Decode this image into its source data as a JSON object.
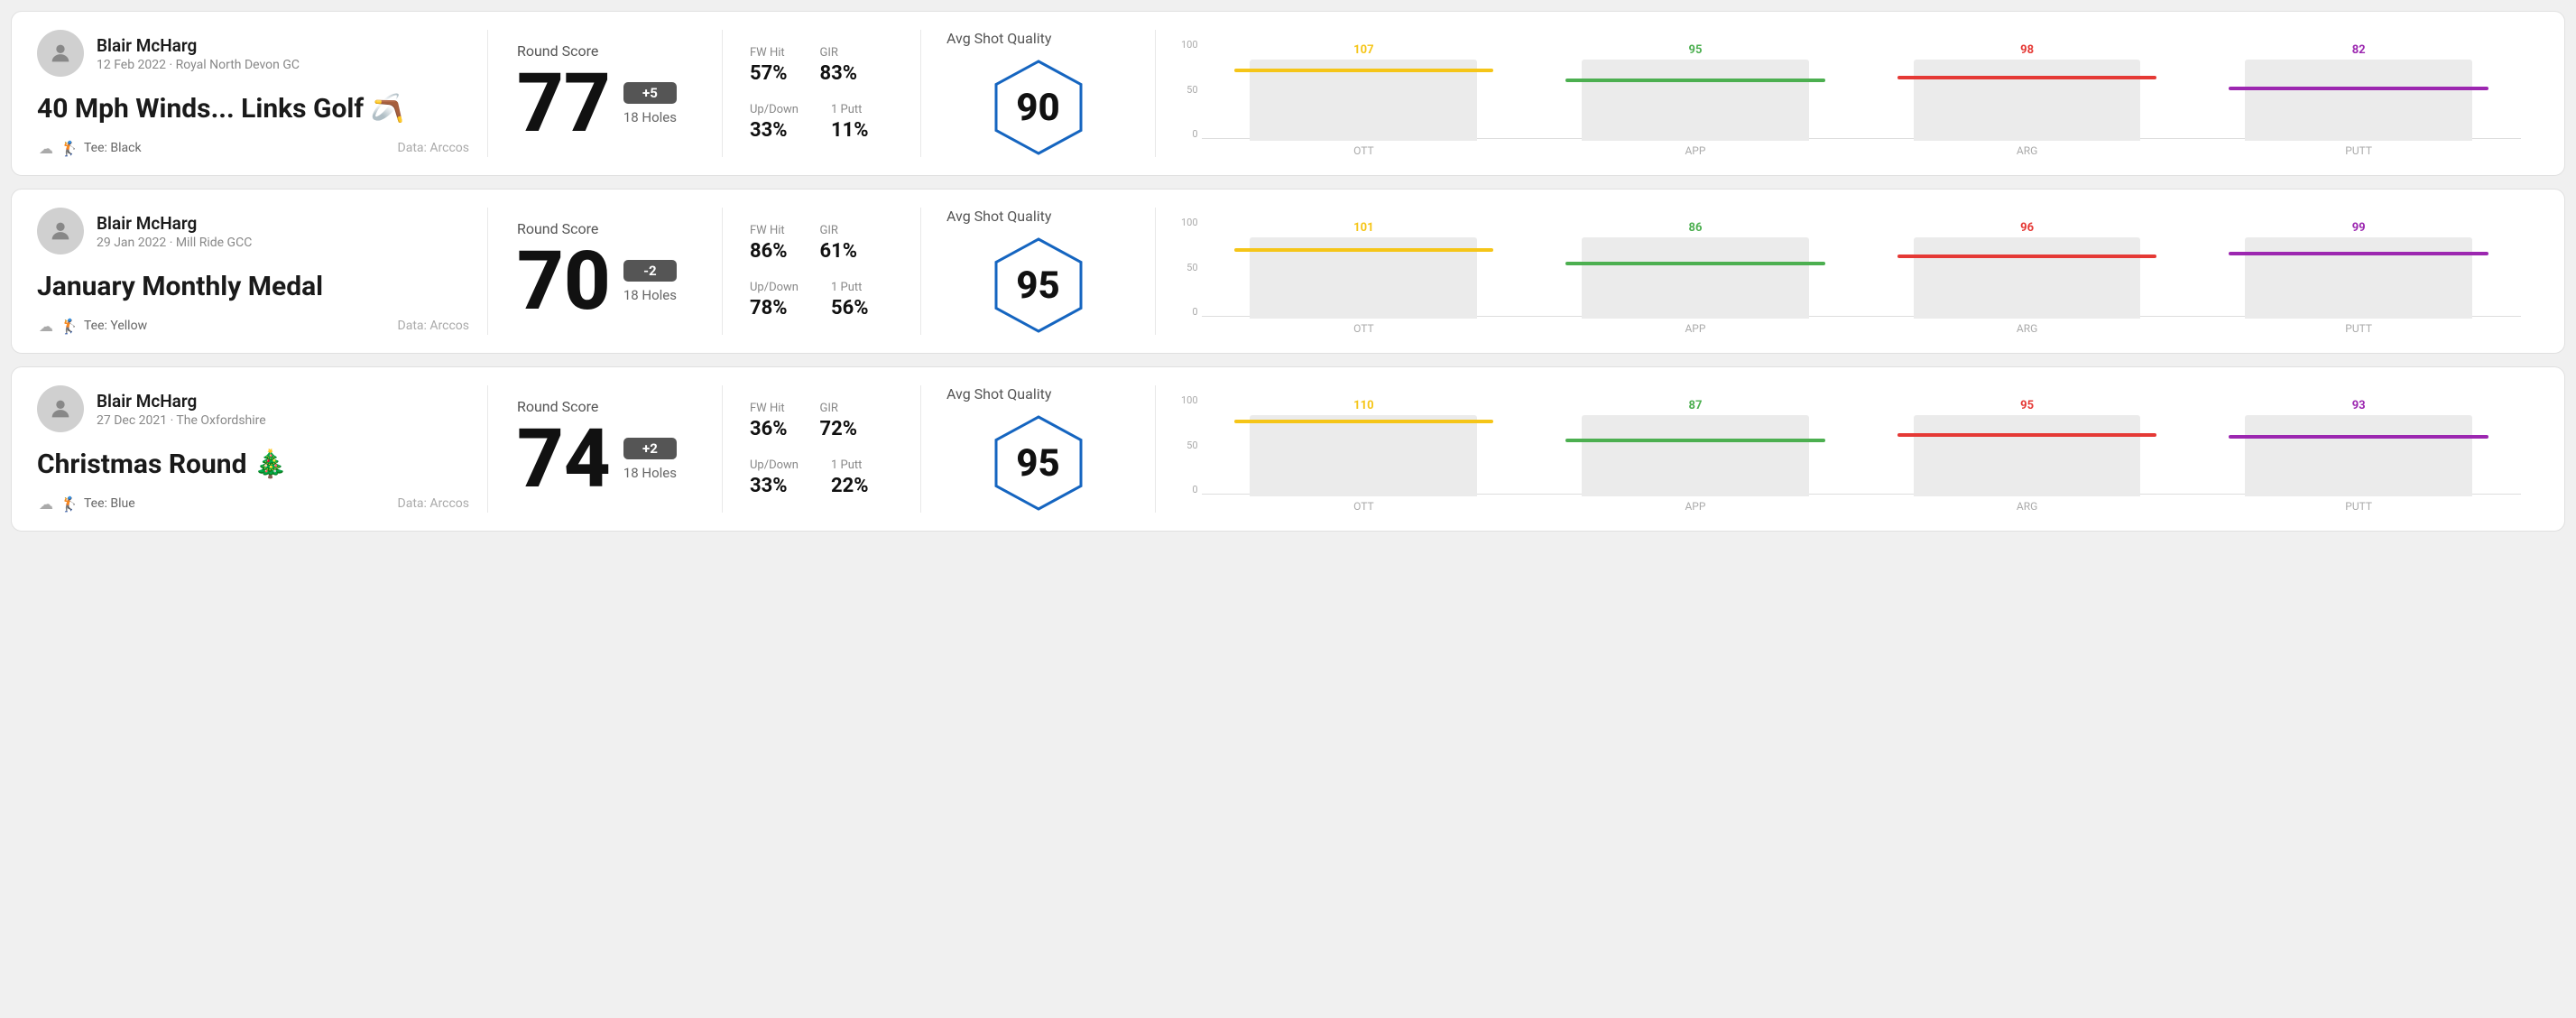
{
  "rounds": [
    {
      "id": "round1",
      "user": {
        "name": "Blair McHarg",
        "meta": "12 Feb 2022 · Royal North Devon GC"
      },
      "title": "40 Mph Winds... Links Golf 🪃",
      "tee": "Black",
      "data_source": "Data: Arccos",
      "score": {
        "label": "Round Score",
        "number": "77",
        "badge": "+5",
        "badge_type": "positive",
        "holes": "18 Holes"
      },
      "stats": {
        "fw_hit_label": "FW Hit",
        "fw_hit_value": "57%",
        "gir_label": "GIR",
        "gir_value": "83%",
        "updown_label": "Up/Down",
        "updown_value": "33%",
        "oneputt_label": "1 Putt",
        "oneputt_value": "11%"
      },
      "quality": {
        "label": "Avg Shot Quality",
        "score": "90"
      },
      "chart": {
        "bars": [
          {
            "label": "OTT",
            "top_label": "107",
            "height_pct": 85,
            "color": "#f5c518"
          },
          {
            "label": "APP",
            "top_label": "95",
            "height_pct": 72,
            "color": "#4caf50"
          },
          {
            "label": "ARG",
            "top_label": "98",
            "height_pct": 76,
            "color": "#e53935"
          },
          {
            "label": "PUTT",
            "top_label": "82",
            "height_pct": 62,
            "color": "#9c27b0"
          }
        ],
        "y_labels": [
          "100",
          "50",
          "0"
        ]
      }
    },
    {
      "id": "round2",
      "user": {
        "name": "Blair McHarg",
        "meta": "29 Jan 2022 · Mill Ride GCC"
      },
      "title": "January Monthly Medal",
      "tee": "Yellow",
      "data_source": "Data: Arccos",
      "score": {
        "label": "Round Score",
        "number": "70",
        "badge": "-2",
        "badge_type": "negative",
        "holes": "18 Holes"
      },
      "stats": {
        "fw_hit_label": "FW Hit",
        "fw_hit_value": "86%",
        "gir_label": "GIR",
        "gir_value": "61%",
        "updown_label": "Up/Down",
        "updown_value": "78%",
        "oneputt_label": "1 Putt",
        "oneputt_value": "56%"
      },
      "quality": {
        "label": "Avg Shot Quality",
        "score": "95"
      },
      "chart": {
        "bars": [
          {
            "label": "OTT",
            "top_label": "101",
            "height_pct": 82,
            "color": "#f5c518"
          },
          {
            "label": "APP",
            "top_label": "86",
            "height_pct": 66,
            "color": "#4caf50"
          },
          {
            "label": "ARG",
            "top_label": "96",
            "height_pct": 74,
            "color": "#e53935"
          },
          {
            "label": "PUTT",
            "top_label": "99",
            "height_pct": 78,
            "color": "#9c27b0"
          }
        ],
        "y_labels": [
          "100",
          "50",
          "0"
        ]
      }
    },
    {
      "id": "round3",
      "user": {
        "name": "Blair McHarg",
        "meta": "27 Dec 2021 · The Oxfordshire"
      },
      "title": "Christmas Round 🎄",
      "tee": "Blue",
      "data_source": "Data: Arccos",
      "score": {
        "label": "Round Score",
        "number": "74",
        "badge": "+2",
        "badge_type": "positive",
        "holes": "18 Holes"
      },
      "stats": {
        "fw_hit_label": "FW Hit",
        "fw_hit_value": "36%",
        "gir_label": "GIR",
        "gir_value": "72%",
        "updown_label": "Up/Down",
        "updown_value": "33%",
        "oneputt_label": "1 Putt",
        "oneputt_value": "22%"
      },
      "quality": {
        "label": "Avg Shot Quality",
        "score": "95"
      },
      "chart": {
        "bars": [
          {
            "label": "OTT",
            "top_label": "110",
            "height_pct": 90,
            "color": "#f5c518"
          },
          {
            "label": "APP",
            "top_label": "87",
            "height_pct": 67,
            "color": "#4caf50"
          },
          {
            "label": "ARG",
            "top_label": "95",
            "height_pct": 73,
            "color": "#e53935"
          },
          {
            "label": "PUTT",
            "top_label": "93",
            "height_pct": 71,
            "color": "#9c27b0"
          }
        ],
        "y_labels": [
          "100",
          "50",
          "0"
        ]
      }
    }
  ]
}
